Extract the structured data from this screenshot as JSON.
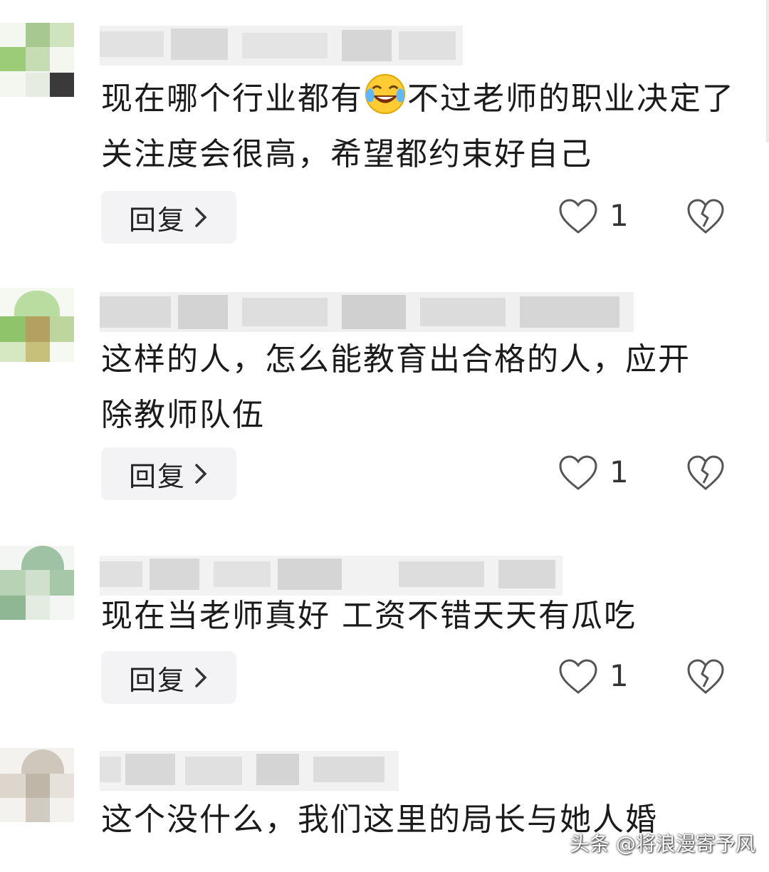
{
  "comments": [
    {
      "text": "现在哪个行业都有",
      "emoji": "laughing-tears-emoji",
      "text_after_emoji": "不过老师的职业决定了关注度会很高，希望都约束好自己",
      "reply_label": "回复",
      "like_count": "1"
    },
    {
      "text": "这样的人，怎么能教育出合格的人，应开除教师队伍",
      "reply_label": "回复",
      "like_count": "1"
    },
    {
      "text": "现在当老师真好 工资不错天天有瓜吃",
      "reply_label": "回复",
      "like_count": "1"
    },
    {
      "text": "这个没什么，我们这里的局长与她人婚"
    }
  ],
  "watermark": "头条 @将浪漫寄予风",
  "icons": {
    "reply_chevron": "chevron-right-icon",
    "like": "heart-outline-icon",
    "dislike": "broken-heart-icon"
  },
  "colors": {
    "background": "#ffffff",
    "text": "#1b1b1b",
    "button_bg": "#f3f3f5",
    "icon": "#555555"
  }
}
